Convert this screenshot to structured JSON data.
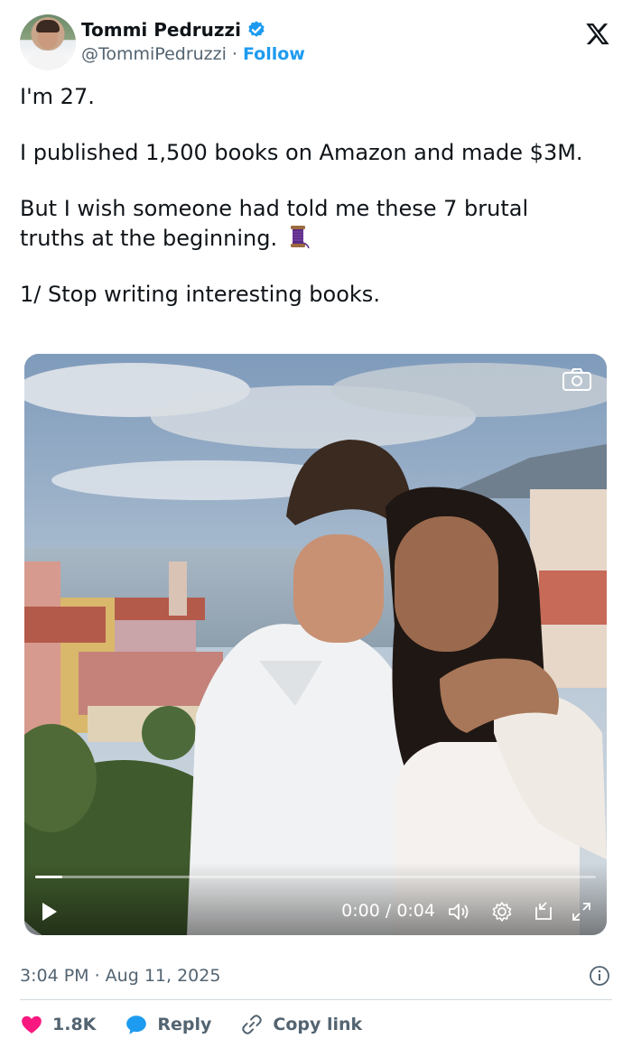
{
  "author": {
    "name": "Tommi Pedruzzi",
    "handle": "@TommiPedruzzi",
    "separator": "·",
    "follow_label": "Follow",
    "verified": true
  },
  "platform_logo": "𝕏",
  "tweet": {
    "paragraphs": [
      "I'm 27.",
      "I published 1,500 books on Amazon and made $3M.",
      "But I wish someone had told me these 7 brutal truths at the beginning.",
      "1/ Stop writing interesting books."
    ],
    "emoji_icon": "thread-spool-icon"
  },
  "video": {
    "time_display": "0:00 / 0:04",
    "progress": 0.0,
    "controls": [
      "play-icon",
      "volume-icon",
      "settings-gear-icon",
      "picture-in-picture-icon",
      "fullscreen-expand-icon"
    ],
    "overlay_icon": "camera-icon"
  },
  "meta": {
    "timestamp": "3:04 PM · Aug 11, 2025"
  },
  "actions": {
    "like_count": "1.8K",
    "reply_label": "Reply",
    "copy_link_label": "Copy link"
  },
  "colors": {
    "accent": "#1d9bf0",
    "like": "#f91880",
    "text": "#0f1419",
    "muted": "#536471"
  }
}
